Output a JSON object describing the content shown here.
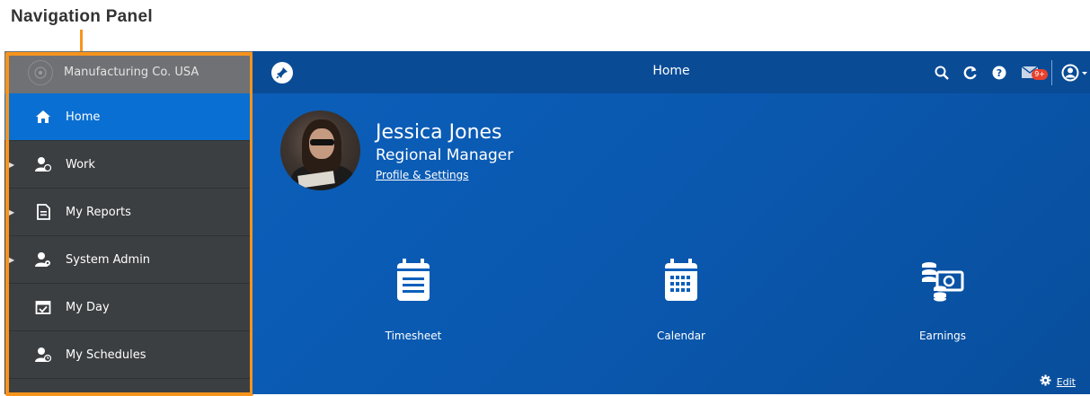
{
  "callout": {
    "title": "Navigation Panel"
  },
  "sidebar": {
    "company": "Manufacturing Co. USA",
    "items": [
      {
        "label": "Home",
        "icon": "home-icon",
        "active": true,
        "expandable": false
      },
      {
        "label": "Work",
        "icon": "user-clock-icon",
        "active": false,
        "expandable": true
      },
      {
        "label": "My Reports",
        "icon": "report-icon",
        "active": false,
        "expandable": true
      },
      {
        "label": "System Admin",
        "icon": "user-gear-icon",
        "active": false,
        "expandable": true
      },
      {
        "label": "My Day",
        "icon": "calendar-check-icon",
        "active": false,
        "expandable": false
      },
      {
        "label": "My Schedules",
        "icon": "user-schedule-icon",
        "active": false,
        "expandable": false
      }
    ]
  },
  "header": {
    "title": "Home",
    "notification_badge": "9+",
    "icons": [
      "pin-icon",
      "search-icon",
      "refresh-icon",
      "help-icon",
      "mail-icon",
      "user-menu-icon"
    ]
  },
  "profile": {
    "name": "Jessica Jones",
    "role": "Regional Manager",
    "link": "Profile & Settings"
  },
  "tiles": [
    {
      "label": "Timesheet",
      "icon": "timesheet-icon"
    },
    {
      "label": "Calendar",
      "icon": "calendar-icon"
    },
    {
      "label": "Earnings",
      "icon": "earnings-icon"
    }
  ],
  "footer": {
    "edit_label": "Edit"
  },
  "colors": {
    "accent_orange": "#f7941d",
    "nav_active": "#0a6fd2",
    "sidebar_bg": "#3c3f42",
    "topbar_bg": "#0a4b96",
    "main_bg": "#0b5fba",
    "badge": "#e8412c"
  }
}
